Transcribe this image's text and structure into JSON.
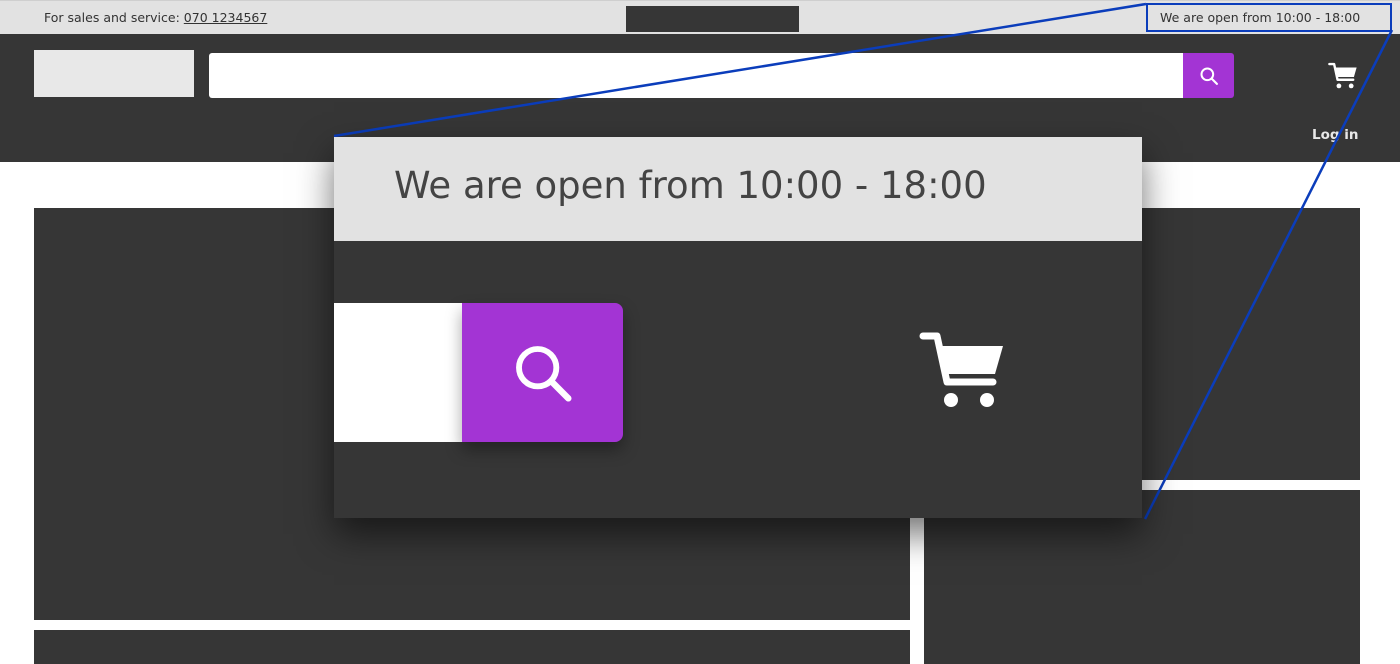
{
  "topbar": {
    "service_label": "For sales and service:",
    "phone": "070 1234567",
    "hours": "We are open from 10:00 - 18:00"
  },
  "header": {
    "search_placeholder": "",
    "login_label": "Log in"
  },
  "zoom": {
    "hours": "We are open from 10:00 - 18:00"
  },
  "icons": {
    "search": "search-icon",
    "cart": "cart-icon"
  },
  "colors": {
    "accent": "#a334d4",
    "header_bg": "#363636",
    "topbar_bg": "#e2e2e2",
    "highlight": "#0b3dbb"
  }
}
